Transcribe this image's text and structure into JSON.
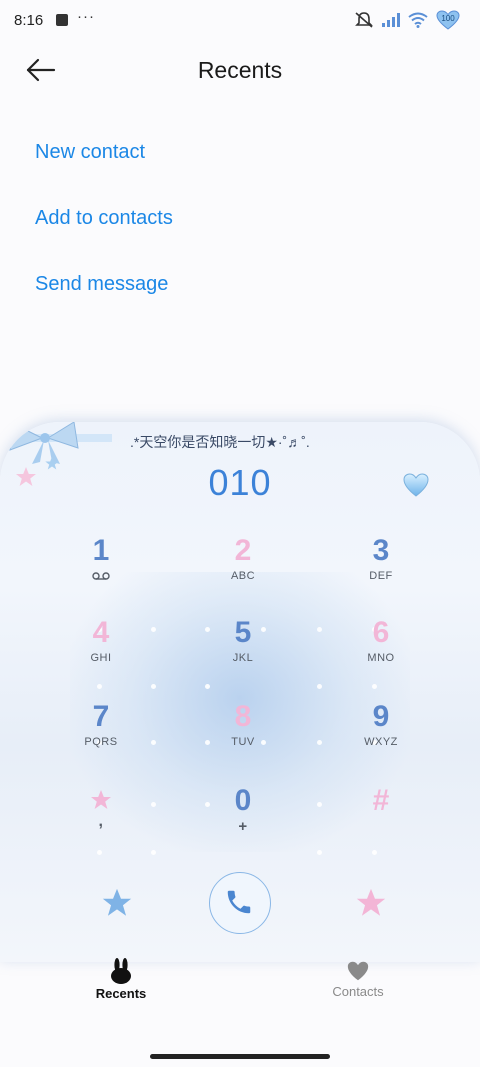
{
  "status_bar": {
    "time": "8:16",
    "more": "···",
    "battery": "100"
  },
  "header": {
    "title": "Recents"
  },
  "menu": {
    "items": [
      {
        "label": "New contact"
      },
      {
        "label": "Add to contacts"
      },
      {
        "label": "Send message"
      }
    ]
  },
  "dialer": {
    "decoration_text": ".*天空你是否知晓一切★·˚♬˚.",
    "number": "010",
    "keys": [
      {
        "digit": "1",
        "letters": ""
      },
      {
        "digit": "2",
        "letters": "ABC"
      },
      {
        "digit": "3",
        "letters": "DEF"
      },
      {
        "digit": "4",
        "letters": "GHI"
      },
      {
        "digit": "5",
        "letters": "JKL"
      },
      {
        "digit": "6",
        "letters": "MNO"
      },
      {
        "digit": "7",
        "letters": "PQRS"
      },
      {
        "digit": "8",
        "letters": "TUV"
      },
      {
        "digit": "9",
        "letters": "WXYZ"
      },
      {
        "digit": "",
        "letters": ","
      },
      {
        "digit": "0",
        "letters": "+"
      },
      {
        "digit": "#",
        "letters": ""
      }
    ]
  },
  "bottom_nav": {
    "tabs": [
      {
        "label": "Recents",
        "active": true
      },
      {
        "label": "Contacts",
        "active": false
      }
    ]
  },
  "colors": {
    "accent_link": "#1b87e6",
    "number_blue": "#3c82d8",
    "key_blue": "#5b86c9",
    "key_pink": "#f2b6d7"
  }
}
